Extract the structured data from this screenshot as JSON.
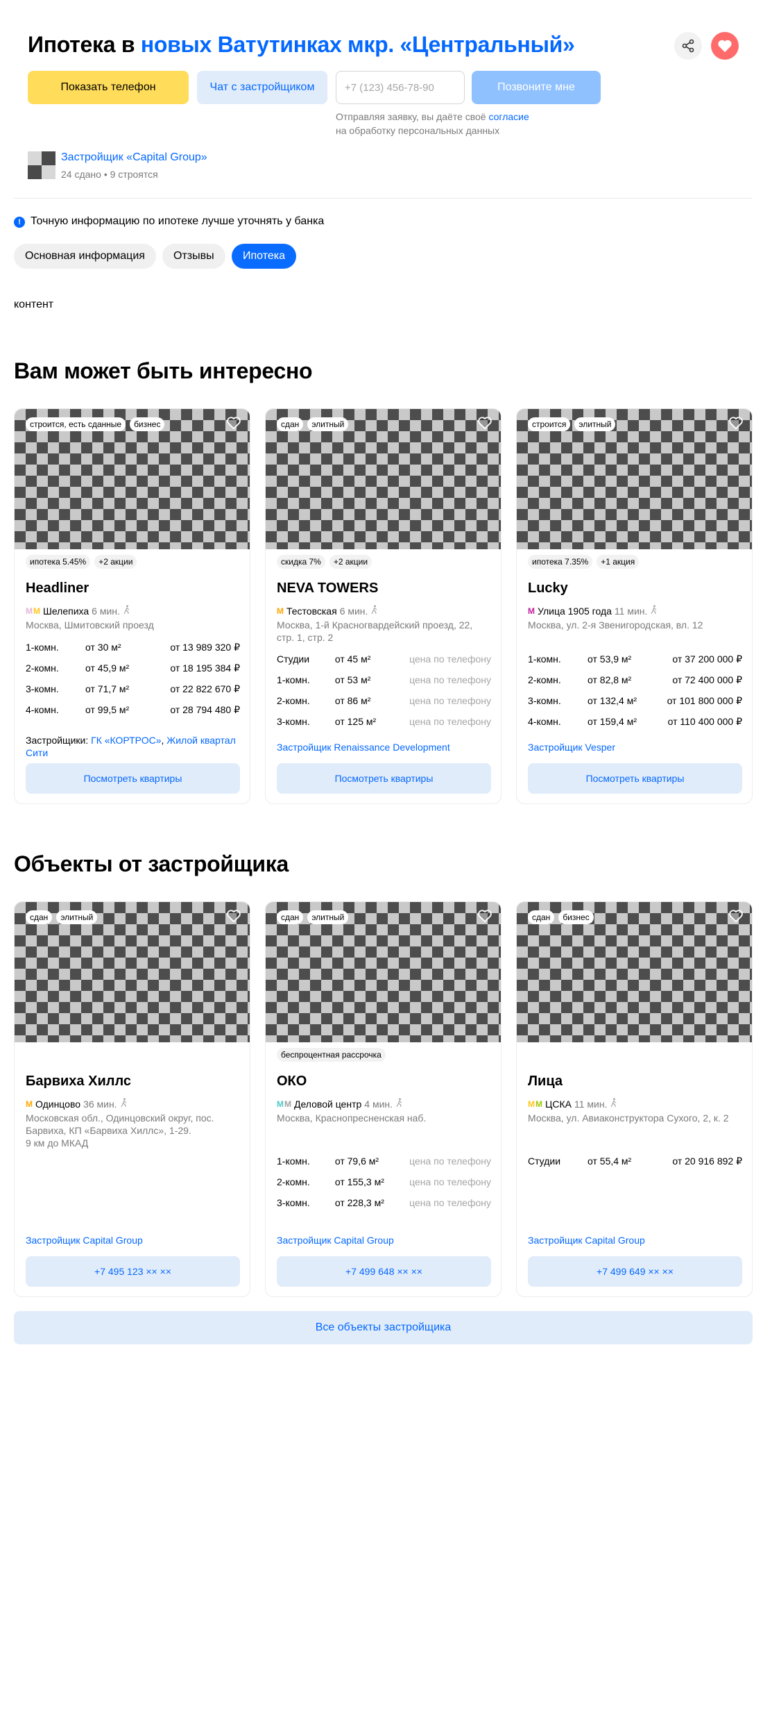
{
  "header": {
    "title_prefix": "Ипотека в ",
    "title_highlight": "новых Ватутинках мкр. «Центральный»",
    "share_icon": "share-icon",
    "favorite_icon": "heart-icon"
  },
  "actions": {
    "show_phone": "Показать телефон",
    "chat": "Чат с застройщиком",
    "phone_placeholder": "+7 (123) 456-78-90",
    "call_me": "Позвоните мне",
    "consent_prefix": "Отправляя заявку, вы даёте своё ",
    "consent_link": "согласие",
    "consent_suffix": "на обработку персональных данных"
  },
  "developer": {
    "name": "Застройщик «Capital Group»",
    "stats": "24 сдано • 9 строятся"
  },
  "info": {
    "text": "Точную информацию по ипотеке лучше уточнять у банка"
  },
  "tabs": [
    {
      "label": "Основная информация",
      "active": false
    },
    {
      "label": "Отзывы",
      "active": false
    },
    {
      "label": "Ипотека",
      "active": true
    }
  ],
  "content_placeholder": "контент",
  "section_interesting": {
    "title": "Вам может быть интересно",
    "cards": [
      {
        "badges": [
          "строится, есть сданные",
          "бизнес"
        ],
        "promos": [
          "ипотека 5.45%",
          "+2 акции"
        ],
        "name": "Headliner",
        "metro_colors": [
          "#e4b4d6",
          "#ffc61a"
        ],
        "metro": "Шелепиха",
        "time": "6 мин.",
        "address": "Москва, Шмитовский проезд",
        "rooms": [
          {
            "type": "1-комн.",
            "area": "от 30 м²",
            "price": "от 13 989 320 ₽"
          },
          {
            "type": "2-комн.",
            "area": "от 45,9 м²",
            "price": "от 18 195 384 ₽"
          },
          {
            "type": "3-комн.",
            "area": "от 71,7 м²",
            "price": "от 22 822 670 ₽"
          },
          {
            "type": "4-комн.",
            "area": "от 99,5 м²",
            "price": "от 28 794 480 ₽"
          }
        ],
        "developer_prefix": "Застройщики: ",
        "developer_links": [
          "ГК «КОРТРОС»",
          "Жилой квартал Сити"
        ],
        "button": "Посмотреть квартиры"
      },
      {
        "badges": [
          "сдан",
          "элитный"
        ],
        "promos": [
          "скидка 7%",
          "+2 акции"
        ],
        "name": "NEVA TOWERS",
        "metro_colors": [
          "#ffa500"
        ],
        "metro": "Тестовская",
        "time": "6 мин.",
        "address": "Москва, 1-й Красногвардейский проезд, 22, стр. 1, стр. 2",
        "rooms": [
          {
            "type": "Студии",
            "area": "от 45 м²",
            "price": "цена по телефону"
          },
          {
            "type": "1-комн.",
            "area": "от 53 м²",
            "price": "цена по телефону"
          },
          {
            "type": "2-комн.",
            "area": "от 86 м²",
            "price": "цена по телефону"
          },
          {
            "type": "3-комн.",
            "area": "от 125 м²",
            "price": "цена по телефону"
          }
        ],
        "developer_link": "Застройщик Renaissance Development",
        "button": "Посмотреть квартиры"
      },
      {
        "badges": [
          "строится",
          "элитный"
        ],
        "promos": [
          "ипотека 7.35%",
          "+1 акция"
        ],
        "name": "Lucky",
        "metro_colors": [
          "#bf1e9e"
        ],
        "metro": "Улица 1905 года",
        "time": "11 мин.",
        "address": "Москва, ул. 2-я Звенигородская, вл. 12",
        "rooms": [
          {
            "type": "1-комн.",
            "area": "от 53,9 м²",
            "price": "от 37 200 000 ₽"
          },
          {
            "type": "2-комн.",
            "area": "от 82,8 м²",
            "price": "от 72 400 000 ₽"
          },
          {
            "type": "3-комн.",
            "area": "от 132,4 м²",
            "price": "от 101 800 000 ₽"
          },
          {
            "type": "4-комн.",
            "area": "от 159,4 м²",
            "price": "от 110 400 000 ₽"
          }
        ],
        "developer_link": "Застройщик Vesper",
        "button": "Посмотреть квартиры"
      }
    ]
  },
  "section_developer": {
    "title": "Объекты от застройщика",
    "cards": [
      {
        "badges": [
          "сдан",
          "элитный"
        ],
        "promos": [],
        "name": "Барвиха Хиллс",
        "metro_colors": [
          "#ffa500"
        ],
        "metro": "Одинцово",
        "time": "36 мин.",
        "address": "Московская обл., Одинцовский округ, пос. Барвиха, КП «Барвиха Хиллс», 1-29.",
        "address2": "9 км до МКАД",
        "rooms": [],
        "developer_link": "Застройщик Capital Group",
        "button": "+7 495 123 ×× ××"
      },
      {
        "badges": [
          "сдан",
          "элитный"
        ],
        "promos": [
          "беспроцентная рассрочка"
        ],
        "name": "ОКО",
        "metro_colors": [
          "#4ec8c8",
          "#a0a0a0"
        ],
        "metro": "Деловой центр",
        "time": "4 мин.",
        "address": "Москва, Краснопресненская наб.",
        "rooms": [
          {
            "type": "1-комн.",
            "area": "от 79,6 м²",
            "price": "цена по телефону"
          },
          {
            "type": "2-комн.",
            "area": "от 155,3 м²",
            "price": "цена по телефону"
          },
          {
            "type": "3-комн.",
            "area": "от 228,3 м²",
            "price": "цена по телефону"
          }
        ],
        "developer_link": "Застройщик Capital Group",
        "button": "+7 499 648 ×× ××"
      },
      {
        "badges": [
          "сдан",
          "бизнес"
        ],
        "promos": [],
        "name": "Лица",
        "metro_colors": [
          "#ffc61a",
          "#a0c800"
        ],
        "metro": "ЦСКА",
        "time": "11 мин.",
        "address": "Москва, ул. Авиаконструктора Сухого, 2, к. 2",
        "rooms": [
          {
            "type": "Студии",
            "area": "от 55,4 м²",
            "price": "от 20 916 892 ₽"
          }
        ],
        "developer_link": "Застройщик Capital Group",
        "button": "+7 499 649 ×× ××"
      }
    ]
  },
  "all_objects_button": "Все объекты застройщика"
}
